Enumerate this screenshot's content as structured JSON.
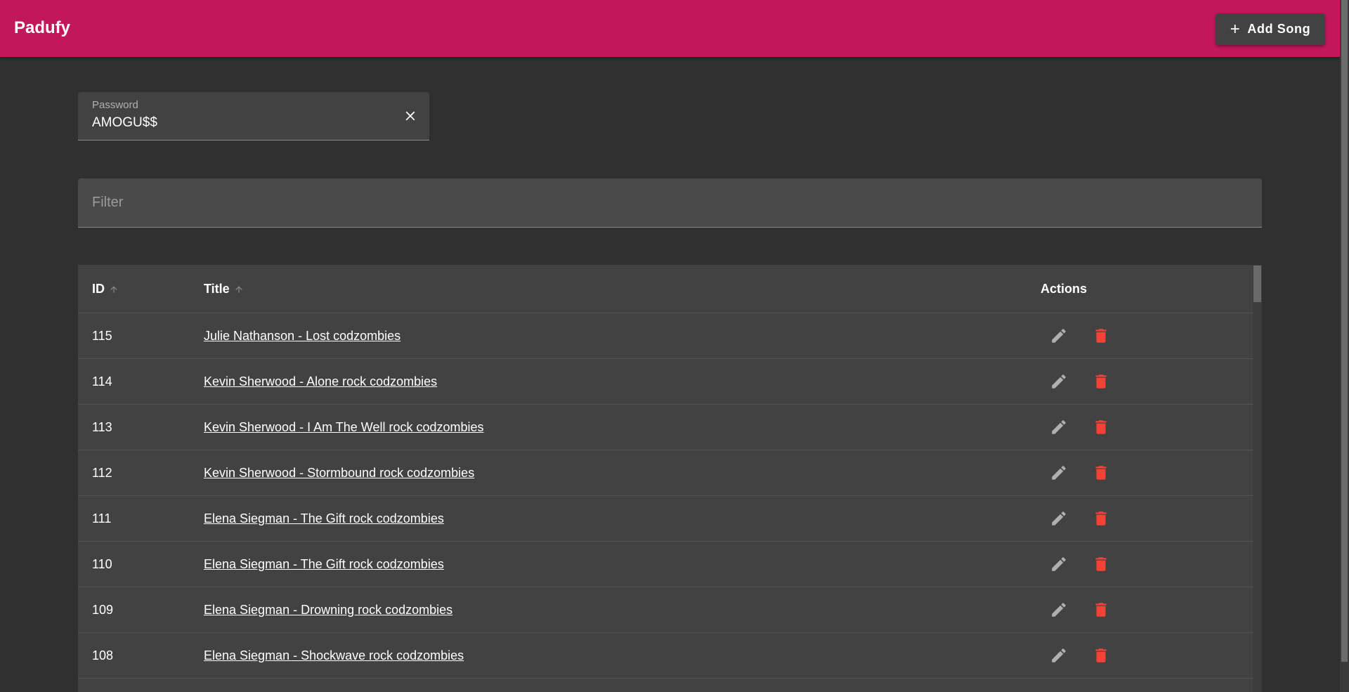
{
  "app": {
    "title": "Padufy"
  },
  "toolbar": {
    "add_song_label": "Add Song"
  },
  "password": {
    "label": "Password",
    "value": "AMOGU$$"
  },
  "filter": {
    "placeholder": "Filter",
    "value": ""
  },
  "table": {
    "headers": {
      "id": "ID",
      "title": "Title",
      "actions": "Actions"
    },
    "rows": [
      {
        "id": "115",
        "title": "Julie Nathanson - Lost codzombies"
      },
      {
        "id": "114",
        "title": "Kevin Sherwood - Alone rock codzombies"
      },
      {
        "id": "113",
        "title": "Kevin Sherwood - I Am The Well rock codzombies"
      },
      {
        "id": "112",
        "title": "Kevin Sherwood - Stormbound rock codzombies"
      },
      {
        "id": "111",
        "title": "Elena Siegman - The Gift rock codzombies"
      },
      {
        "id": "110",
        "title": "Elena Siegman - The Gift rock codzombies"
      },
      {
        "id": "109",
        "title": "Elena Siegman - Drowning rock codzombies"
      },
      {
        "id": "108",
        "title": "Elena Siegman - Shockwave rock codzombies"
      }
    ]
  },
  "colors": {
    "appbar": "#c2185b",
    "background": "#303030",
    "delete": "#f44336",
    "edit": "#b0b0b0"
  },
  "icons": {
    "add": "plus-icon",
    "clear": "close-icon",
    "sort": "arrow-up-icon",
    "edit": "pencil-icon",
    "delete": "trash-icon"
  }
}
